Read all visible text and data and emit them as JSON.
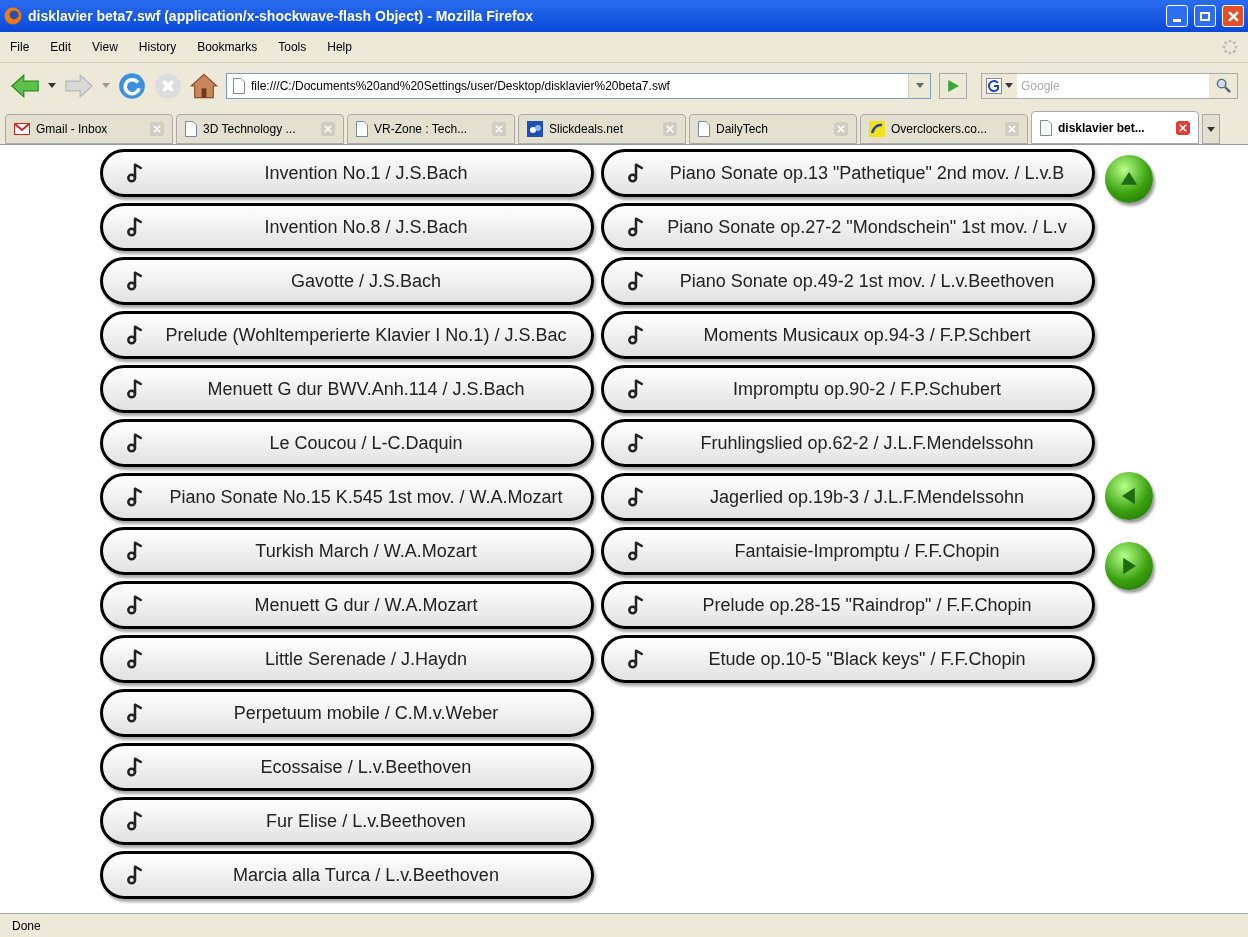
{
  "window": {
    "title": "disklavier beta7.swf (application/x-shockwave-flash Object) - Mozilla Firefox"
  },
  "menu": [
    "File",
    "Edit",
    "View",
    "History",
    "Bookmarks",
    "Tools",
    "Help"
  ],
  "address": {
    "value": "file:///C:/Documents%20and%20Settings/user/Desktop/disklavier%20beta7.swf"
  },
  "search": {
    "placeholder": "Google"
  },
  "tabs": [
    {
      "label": "Gmail - Inbox",
      "kind": "mail",
      "selected": false
    },
    {
      "label": "3D Technology ...",
      "kind": "page",
      "selected": false
    },
    {
      "label": "VR-Zone : Tech...",
      "kind": "page",
      "selected": false
    },
    {
      "label": "Slickdeals.net",
      "kind": "blue",
      "selected": false
    },
    {
      "label": "DailyTech",
      "kind": "page",
      "selected": false
    },
    {
      "label": "Overclockers.co...",
      "kind": "yellow",
      "selected": false
    },
    {
      "label": "disklavier bet...",
      "kind": "page",
      "selected": true
    }
  ],
  "songs_left": [
    "Invention No.1 / J.S.Bach",
    "Invention No.8 / J.S.Bach",
    "Gavotte / J.S.Bach",
    "Prelude (Wohltemperierte Klavier I No.1) / J.S.Bac",
    "Menuett G dur BWV.Anh.114 / J.S.Bach",
    "Le Coucou / L-C.Daquin",
    "Piano Sonate No.15 K.545 1st mov. / W.A.Mozart",
    "Turkish March / W.A.Mozart",
    "Menuett G dur / W.A.Mozart",
    "Little Serenade / J.Haydn",
    "Perpetuum mobile / C.M.v.Weber",
    "Ecossaise / L.v.Beethoven",
    "Fur Elise / L.v.Beethoven",
    "Marcia alla Turca / L.v.Beethoven"
  ],
  "songs_right": [
    "Piano Sonate op.13 \"Pathetique\" 2nd mov. / L.v.B",
    "Piano Sonate op.27-2 \"Mondschein\" 1st mov. / L.v",
    "Piano Sonate op.49-2 1st mov. / L.v.Beethoven",
    "Moments Musicaux op.94-3 / F.P.Schbert",
    "Impromptu op.90-2 / F.P.Schubert",
    "Fruhlingslied op.62-2 / J.L.F.Mendelssohn",
    "Jagerlied op.19b-3 / J.L.F.Mendelssohn",
    "Fantaisie-Impromptu / F.F.Chopin",
    "Prelude op.28-15 \"Raindrop\" / F.F.Chopin",
    "Etude op.10-5 \"Black keys\" / F.F.Chopin"
  ],
  "status_bar": "Done"
}
